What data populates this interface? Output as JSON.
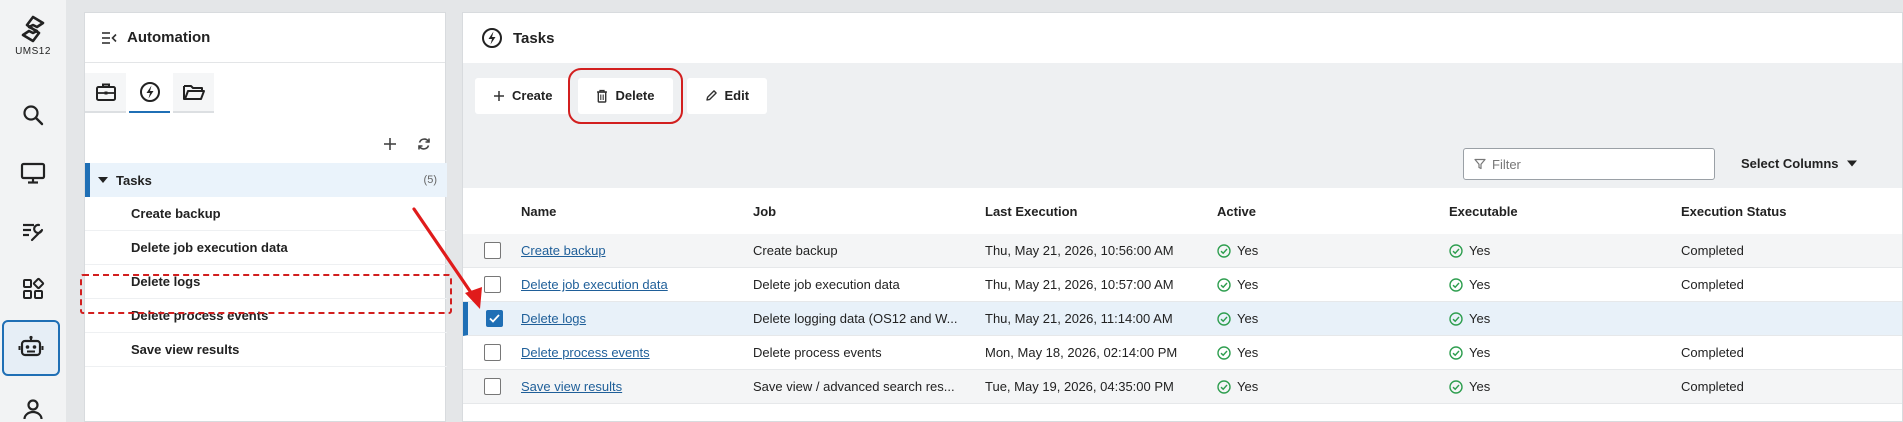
{
  "brand": {
    "logo_text": "UMS12"
  },
  "rail": {
    "items": [
      {
        "name": "search",
        "icon": "search-icon"
      },
      {
        "name": "devices",
        "icon": "monitor-icon"
      },
      {
        "name": "configuration",
        "icon": "tools-icon"
      },
      {
        "name": "apps",
        "icon": "apps-icon"
      },
      {
        "name": "automation",
        "icon": "robot-icon",
        "active": true
      },
      {
        "name": "users",
        "icon": "user-icon"
      }
    ]
  },
  "side": {
    "title": "Automation",
    "tabs": [
      {
        "icon": "briefcase-icon"
      },
      {
        "icon": "lightning-icon",
        "active": true
      },
      {
        "icon": "folder-icon"
      }
    ],
    "tree": {
      "root_label": "Tasks",
      "root_count": "(5)",
      "items": [
        "Create backup",
        "Delete job execution data",
        "Delete logs",
        "Delete process events",
        "Save view results"
      ]
    }
  },
  "main": {
    "title": "Tasks",
    "toolbar": {
      "create_label": "Create",
      "delete_label": "Delete",
      "edit_label": "Edit"
    },
    "filter_placeholder": "Filter",
    "select_columns_label": "Select Columns",
    "columns": [
      "Name",
      "Job",
      "Last Execution",
      "Active",
      "Executable",
      "Execution Status"
    ],
    "rows": [
      {
        "name": "Create backup",
        "job": "Create backup",
        "last": "Thu, May 21, 2026, 10:56:00 AM",
        "active": "Yes",
        "executable": "Yes",
        "status": "Completed",
        "checked": false
      },
      {
        "name": "Delete job execution data",
        "job": "Delete job execution data",
        "last": "Thu, May 21, 2026, 10:57:00 AM",
        "active": "Yes",
        "executable": "Yes",
        "status": "Completed",
        "checked": false
      },
      {
        "name": "Delete logs",
        "job": "Delete logging data (OS12 and W...",
        "last": "Thu, May 21, 2026, 11:14:00 AM",
        "active": "Yes",
        "executable": "Yes",
        "status": "",
        "checked": true
      },
      {
        "name": "Delete process events",
        "job": "Delete process events",
        "last": "Mon, May 18, 2026, 02:14:00 PM",
        "active": "Yes",
        "executable": "Yes",
        "status": "Completed",
        "checked": false
      },
      {
        "name": "Save view results",
        "job": "Save view / advanced search res...",
        "last": "Tue, May 19, 2026, 04:35:00 PM",
        "active": "Yes",
        "executable": "Yes",
        "status": "Completed",
        "checked": false
      }
    ]
  },
  "colors": {
    "accent": "#1f6fb5",
    "highlight": "#d21f1f",
    "success": "#2e9e4f"
  }
}
